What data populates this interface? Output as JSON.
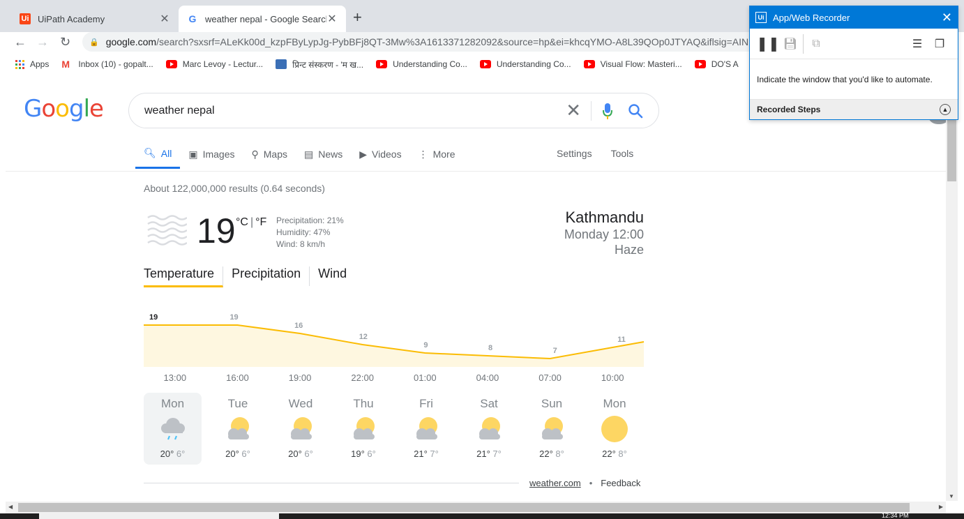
{
  "browser": {
    "tabs": [
      {
        "title": "UiPath Academy",
        "favicon": "uipath-icon"
      },
      {
        "title": "weather nepal - Google Search",
        "favicon": "google-icon",
        "active": true
      }
    ],
    "url_host": "google.com",
    "url_path": "/search?sxsrf=ALeKk00d_kzpFByLypJg-PybBFj8QT-3Mw%3A1613371282092&source=hp&ei=khcqYMO-A8L39QOp0JTYAQ&iflsig=AINFCb",
    "bookmarks": [
      {
        "label": "Apps",
        "icon": "apps-grid-icon"
      },
      {
        "label": "Inbox (10) - gopalt...",
        "icon": "gmail-icon"
      },
      {
        "label": "Marc Levoy - Lectur...",
        "icon": "youtube-icon"
      },
      {
        "label": "प्रिन्ट संस्करण - 'म ख...",
        "icon": "site-icon"
      },
      {
        "label": "Understanding Co...",
        "icon": "youtube-icon"
      },
      {
        "label": "Understanding Co...",
        "icon": "youtube-icon"
      },
      {
        "label": "Visual Flow: Masteri...",
        "icon": "youtube-icon"
      },
      {
        "label": "DO'S A",
        "icon": "youtube-icon"
      }
    ]
  },
  "search": {
    "query": "weather nepal",
    "tabs": [
      {
        "label": "All",
        "icon": "search-icon",
        "selected": true
      },
      {
        "label": "Images",
        "icon": "image-icon"
      },
      {
        "label": "Maps",
        "icon": "map-pin-icon"
      },
      {
        "label": "News",
        "icon": "news-icon"
      },
      {
        "label": "Videos",
        "icon": "video-icon"
      },
      {
        "label": "More",
        "icon": "more-vert-icon"
      }
    ],
    "settings_label": "Settings",
    "tools_label": "Tools",
    "stats": "About 122,000,000 results (0.64 seconds)"
  },
  "weather": {
    "temperature": "19",
    "unit_c": "°C",
    "unit_sep": "|",
    "unit_f": "°F",
    "precipitation": "Precipitation: 21%",
    "humidity": "Humidity: 47%",
    "wind": "Wind: 8 km/h",
    "location": "Kathmandu",
    "datetime": "Monday 12:00",
    "condition": "Haze",
    "tabs": [
      "Temperature",
      "Precipitation",
      "Wind"
    ],
    "forecast": [
      {
        "day": "Mon",
        "icon": "rain-cloud-icon",
        "hi": "20°",
        "lo": "6°"
      },
      {
        "day": "Tue",
        "icon": "partly-cloudy-icon",
        "hi": "20°",
        "lo": "6°"
      },
      {
        "day": "Wed",
        "icon": "partly-cloudy-icon",
        "hi": "20°",
        "lo": "6°"
      },
      {
        "day": "Thu",
        "icon": "partly-cloudy-icon",
        "hi": "19°",
        "lo": "6°"
      },
      {
        "day": "Fri",
        "icon": "partly-cloudy-icon",
        "hi": "21°",
        "lo": "7°"
      },
      {
        "day": "Sat",
        "icon": "partly-cloudy-icon",
        "hi": "21°",
        "lo": "7°"
      },
      {
        "day": "Sun",
        "icon": "partly-cloudy-icon",
        "hi": "22°",
        "lo": "8°"
      },
      {
        "day": "Mon",
        "icon": "sunny-icon",
        "hi": "22°",
        "lo": "8°"
      }
    ],
    "source": "weather.com",
    "feedback": "Feedback",
    "bullet": "•"
  },
  "chart_data": {
    "type": "area",
    "x": [
      "13:00",
      "16:00",
      "19:00",
      "22:00",
      "01:00",
      "04:00",
      "07:00",
      "10:00"
    ],
    "values": [
      19,
      19,
      16,
      12,
      9,
      8,
      7,
      11
    ],
    "ylim": [
      0,
      25
    ],
    "color": "#fbbc04",
    "fill": "#fef7e0"
  },
  "recorder": {
    "title": "App/Web Recorder",
    "logo": "Ui",
    "message": "Indicate the window that you'd like to automate.",
    "steps_label": "Recorded Steps"
  },
  "taskbar": {
    "clock": "12:34 PM"
  },
  "colors": {
    "google_blue": "#4285f4",
    "google_red": "#ea4335",
    "google_yellow": "#fbbc05",
    "google_green": "#34a853",
    "uipath_orange": "#fa4616",
    "recorder_blue": "#0078d7"
  }
}
